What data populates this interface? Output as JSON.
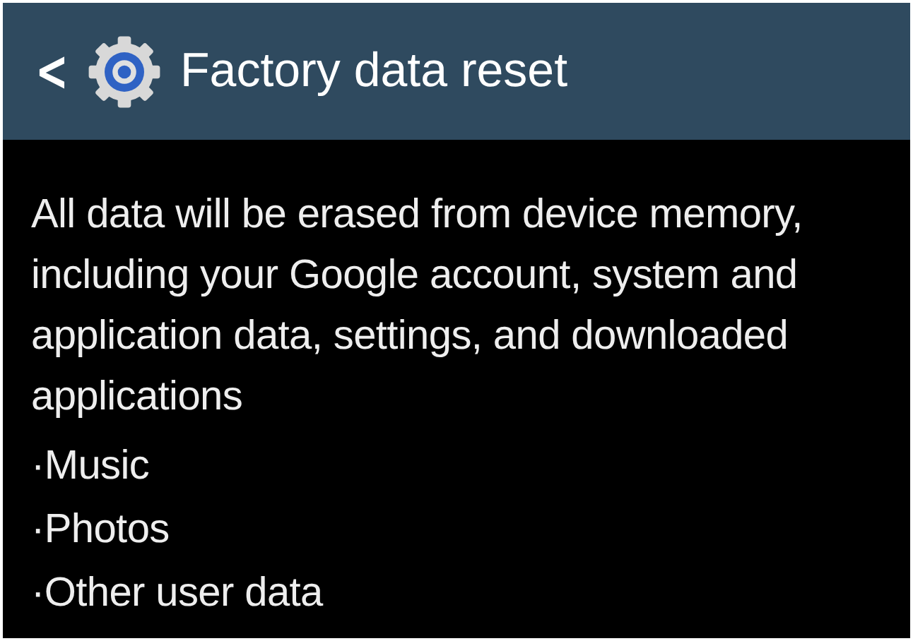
{
  "header": {
    "back": "<",
    "title": "Factory data reset"
  },
  "message": "All data will be erased from device memory, including your Google account, system and application data, settings, and downloaded applications",
  "items": [
    "·Music",
    "·Photos",
    "·Other user data"
  ]
}
